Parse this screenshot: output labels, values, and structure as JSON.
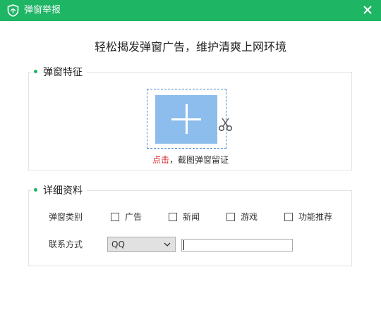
{
  "window": {
    "title": "弹窗举报",
    "brand_color": "#1eb564"
  },
  "headline": "轻松揭发弹窗广告，维护清爽上网环境",
  "features": {
    "title": "弹窗特征",
    "hint_link": "点击",
    "hint_rest": "，截图弹窗留证"
  },
  "details": {
    "title": "详细资料",
    "category_label": "弹窗类别",
    "categories": [
      "广告",
      "新闻",
      "游戏",
      "功能推荐"
    ],
    "contact_label": "联系方式",
    "contact_type": "QQ",
    "contact_value": ""
  },
  "icons": {
    "logo": "shield-logo-icon",
    "close": "close-icon",
    "scissors": "scissors-icon",
    "dropdown": "chevron-down-icon",
    "add": "plus-icon"
  }
}
